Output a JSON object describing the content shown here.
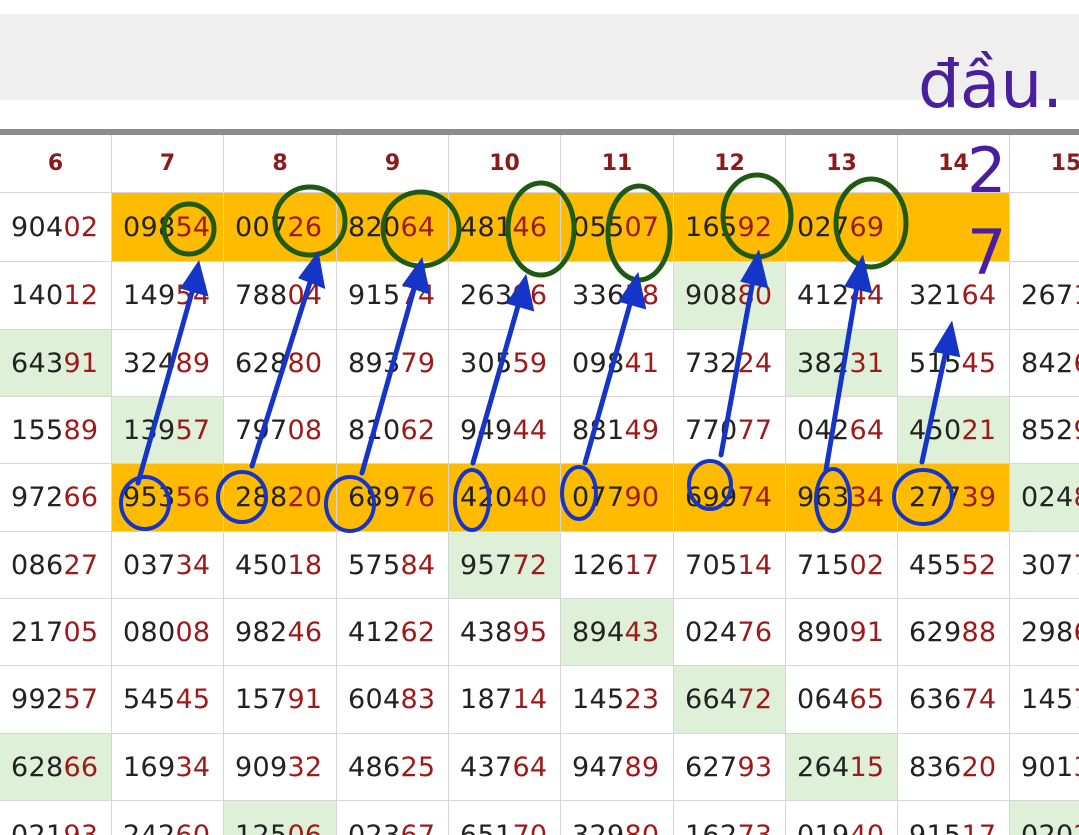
{
  "columns": [
    "6",
    "7",
    "8",
    "9",
    "10",
    "11",
    "12",
    "13",
    "14",
    "15"
  ],
  "rows": [
    {
      "highlight": true,
      "green": [],
      "cells": [
        "90402",
        "09854",
        "00726",
        "82064",
        "48146",
        "05507",
        "16592",
        "02769",
        "",
        ""
      ]
    },
    {
      "highlight": false,
      "green": [
        6
      ],
      "cells": [
        "14012",
        "14954",
        "78804",
        "91574",
        "26396",
        "33658",
        "90880",
        "41244",
        "32164",
        "2671"
      ]
    },
    {
      "highlight": false,
      "green": [
        0,
        7
      ],
      "cells": [
        "64391",
        "32489",
        "62880",
        "89379",
        "30559",
        "09841",
        "73224",
        "38231",
        "51545",
        "8426"
      ]
    },
    {
      "highlight": false,
      "green": [
        1,
        8
      ],
      "cells": [
        "15589",
        "13957",
        "79708",
        "81062",
        "94944",
        "88149",
        "77077",
        "04264",
        "45021",
        "8529"
      ]
    },
    {
      "highlight": true,
      "green": [
        9
      ],
      "cells": [
        "97266",
        "95356",
        "28820",
        "68976",
        "42040",
        "07790",
        "69974",
        "96334",
        "27739",
        "0248"
      ]
    },
    {
      "highlight": false,
      "green": [
        4
      ],
      "cells": [
        "08627",
        "03734",
        "45018",
        "57584",
        "95772",
        "12617",
        "70514",
        "71502",
        "45552",
        "3077"
      ]
    },
    {
      "highlight": false,
      "green": [
        5
      ],
      "cells": [
        "21705",
        "08008",
        "98246",
        "41262",
        "43895",
        "89443",
        "02476",
        "89091",
        "62988",
        "2986"
      ]
    },
    {
      "highlight": false,
      "green": [
        6
      ],
      "cells": [
        "99257",
        "54545",
        "15791",
        "60483",
        "18714",
        "14523",
        "66472",
        "06465",
        "63674",
        "1457"
      ]
    },
    {
      "highlight": false,
      "green": [
        0,
        7
      ],
      "cells": [
        "62866",
        "16934",
        "90932",
        "48625",
        "43764",
        "94789",
        "62793",
        "26415",
        "83620",
        "9013"
      ]
    },
    {
      "highlight": false,
      "green": [
        2,
        9
      ],
      "cells": [
        "02193",
        "24260",
        "12506",
        "02367",
        "65170",
        "32980",
        "16273",
        "01940",
        "91517",
        "0202"
      ]
    }
  ],
  "annotations": {
    "heading": "đầu.",
    "digit_top": "2",
    "digit_bottom": "7"
  },
  "colors": {
    "highlight_row": "#ffbb00",
    "green_cell": "#dff0d8",
    "header_text": "#8b1a1a",
    "suffix_text": "#9e1a1a",
    "circle_green": "#1f5a12",
    "arrow_blue": "#1535c8",
    "annotation_purple": "#4a1f9e"
  }
}
